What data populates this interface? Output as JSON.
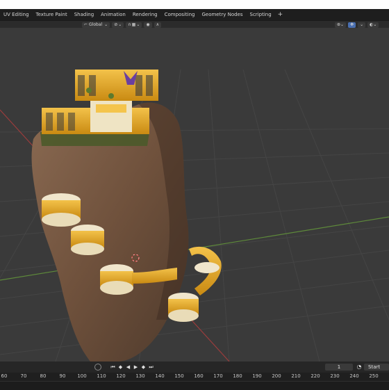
{
  "workspace_tabs": [
    "UV Editing",
    "Texture Paint",
    "Shading",
    "Animation",
    "Rendering",
    "Compositing",
    "Geometry Nodes",
    "Scripting"
  ],
  "add_tab_label": "+",
  "header": {
    "orientation": "Global",
    "orientation_chevron": "⌄",
    "snap_icon": "magnet-icon",
    "proportional_icon": "proportional-icon"
  },
  "timeline": {
    "current_frame": "1",
    "start_label": "Start",
    "frame_numbers": [
      "60",
      "70",
      "80",
      "90",
      "100",
      "110",
      "120",
      "130",
      "140",
      "150",
      "160",
      "170",
      "180",
      "190",
      "200",
      "210",
      "220",
      "230",
      "240",
      "250"
    ]
  },
  "colors": {
    "accent": "#4a6fb0",
    "viewport_bg": "#3a3a3a",
    "header_bg": "#2b2b2b"
  }
}
